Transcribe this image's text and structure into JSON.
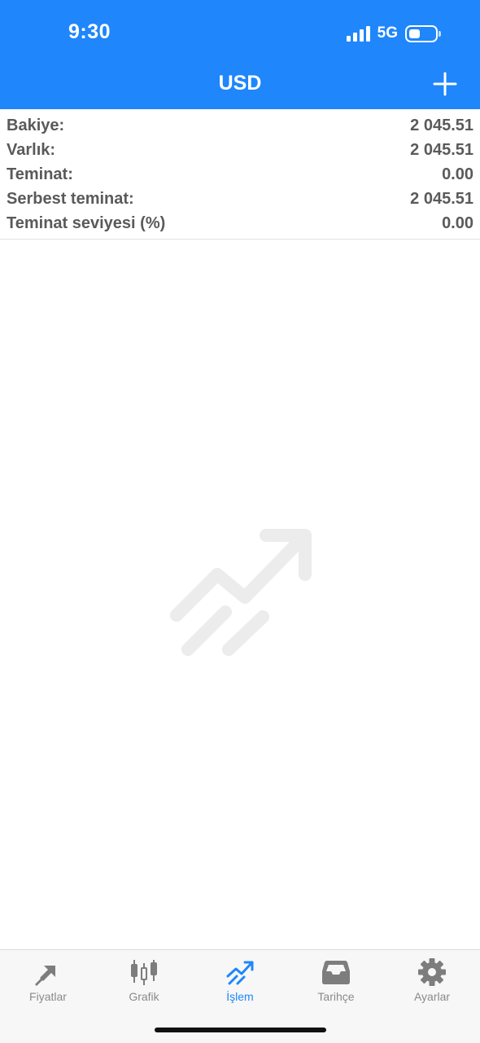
{
  "status_bar": {
    "time": "9:30",
    "network": "5G"
  },
  "nav": {
    "title": "USD",
    "add_icon": "plus-icon"
  },
  "account": {
    "rows": [
      {
        "label": "Bakiye:",
        "value": "2 045.51"
      },
      {
        "label": "Varlık:",
        "value": "2 045.51"
      },
      {
        "label": "Teminat:",
        "value": "0.00"
      },
      {
        "label": "Serbest teminat:",
        "value": "2 045.51"
      },
      {
        "label": "Teminat seviyesi (%)",
        "value": "0.00"
      }
    ]
  },
  "tabs": [
    {
      "label": "Fiyatlar",
      "icon": "quotes-arrows-icon",
      "active": false
    },
    {
      "label": "Grafik",
      "icon": "candlestick-chart-icon",
      "active": false
    },
    {
      "label": "İşlem",
      "icon": "trade-trend-icon",
      "active": true
    },
    {
      "label": "Tarihçe",
      "icon": "history-tray-icon",
      "active": false
    },
    {
      "label": "Ayarlar",
      "icon": "gear-icon",
      "active": false
    }
  ],
  "colors": {
    "accent": "#1f86fb",
    "text": "#5a5a5a",
    "tab_inactive": "#8a8a8a",
    "watermark": "#ececec"
  }
}
